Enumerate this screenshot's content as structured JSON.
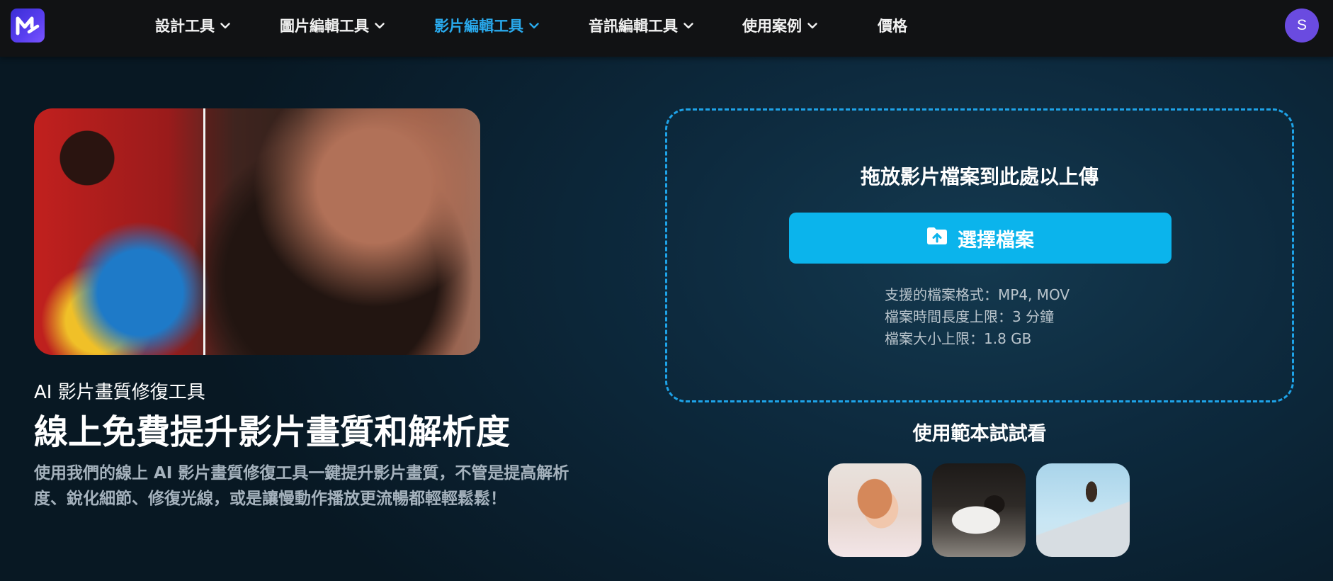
{
  "nav": {
    "items": [
      {
        "label": "設計工具",
        "dropdown": true,
        "active": false
      },
      {
        "label": "圖片編輯工具",
        "dropdown": true,
        "active": false
      },
      {
        "label": "影片編輯工具",
        "dropdown": true,
        "active": true
      },
      {
        "label": "音訊編輯工具",
        "dropdown": true,
        "active": false
      },
      {
        "label": "使用案例",
        "dropdown": true,
        "active": false
      },
      {
        "label": "價格",
        "dropdown": false,
        "active": false
      }
    ],
    "avatar_initial": "S",
    "active_color": "#29a9ec"
  },
  "hero": {
    "subtitle": "AI 影片畫質修復工具",
    "title": "線上免費提升影片畫質和解析度",
    "description": "使用我們的線上 AI 影片畫質修復工具一鍵提升影片畫質，不管是提高解析度、銳化細節、修復光線，或是讓慢動作播放更流暢都輕輕鬆鬆！"
  },
  "upload": {
    "drop_text": "拖放影片檔案到此處以上傳",
    "button_label": "選擇檔案",
    "specs": [
      "支援的檔案格式：MP4, MOV",
      "檔案時間長度上限：3 分鐘",
      "檔案大小上限：1.8 GB"
    ],
    "accent_color": "#0bb4ec"
  },
  "samples": {
    "title": "使用範本試試看",
    "items": [
      "sample-woman-phone",
      "sample-dog",
      "sample-jump"
    ]
  }
}
